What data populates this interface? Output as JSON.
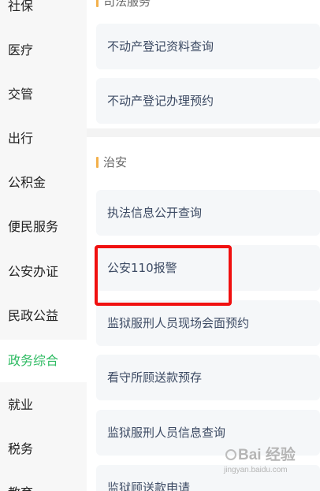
{
  "sidebar": {
    "items": [
      {
        "label": "社保"
      },
      {
        "label": "医疗"
      },
      {
        "label": "交管"
      },
      {
        "label": "出行"
      },
      {
        "label": "公积金"
      },
      {
        "label": "便民服务"
      },
      {
        "label": "公安办证"
      },
      {
        "label": "民政公益"
      },
      {
        "label": "政务综合",
        "active": true
      },
      {
        "label": "就业"
      },
      {
        "label": "税务"
      },
      {
        "label": "教育"
      }
    ],
    "active_color": "#2fbb63"
  },
  "sections": [
    {
      "title": "司法服务",
      "items": [
        "不动产登记资料查询",
        "不动产登记办理预约"
      ]
    },
    {
      "title": "治安",
      "items": [
        "执法信息公开查询",
        "公安110报警",
        "监狱服刑人员现场会面预约",
        "看守所顾送款预存",
        "监狱服刑人员信息查询",
        "监狱顾送款申请"
      ]
    }
  ],
  "highlight": {
    "target": "公安110报警",
    "color": "#f01010"
  },
  "watermark": {
    "logo": "Bai 经验",
    "url": "jingyan.baidu.com"
  }
}
